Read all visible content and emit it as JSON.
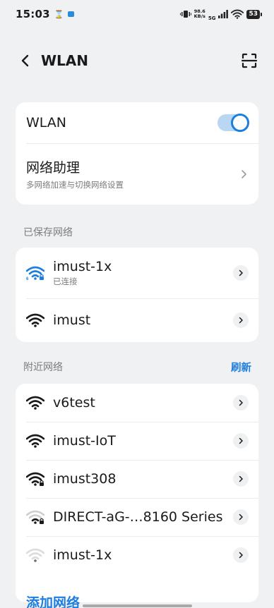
{
  "status_bar": {
    "time": "15:03",
    "net_speed_value": "98.6",
    "net_speed_unit": "KB/s",
    "network_type": "5G",
    "battery": "53"
  },
  "header": {
    "title": "WLAN"
  },
  "wlan_card": {
    "wlan_label": "WLAN",
    "wlan_enabled": true,
    "assistant_title": "网络助理",
    "assistant_subtitle": "多网络加速与切换网络设置"
  },
  "saved_section": {
    "label": "已保存网络",
    "networks": [
      {
        "name": "imust-1x",
        "status": "已连接",
        "icon": "wifi-6-connected-icon"
      },
      {
        "name": "imust",
        "status": "",
        "icon": "wifi-icon"
      }
    ]
  },
  "nearby_section": {
    "label": "附近网络",
    "refresh_label": "刷新",
    "networks": [
      {
        "name": "v6test",
        "icon": "wifi-full-icon"
      },
      {
        "name": "imust-IoT",
        "icon": "wifi-full-icon"
      },
      {
        "name": "imust308",
        "icon": "wifi-locked-icon"
      },
      {
        "name": "DIRECT-aG-…8160 Series",
        "icon": "wifi-weak-locked-icon"
      },
      {
        "name": "imust-1x",
        "icon": "wifi-faint-icon"
      }
    ]
  },
  "add_network_label": "添加网络",
  "colors": {
    "accent": "#1e7ee0",
    "background": "#f0f1f3",
    "card": "#ffffff"
  }
}
